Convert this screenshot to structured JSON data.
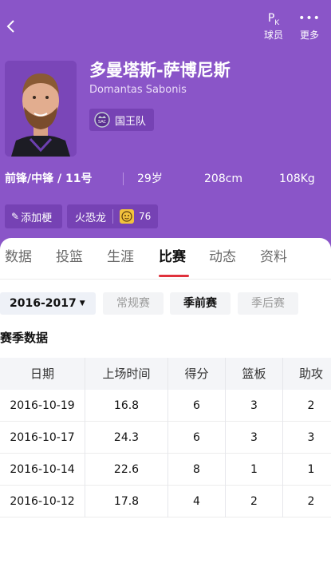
{
  "header": {
    "pk_label": "球员",
    "more_label": "更多",
    "player": {
      "name_cn": "多曼塔斯-萨博尼斯",
      "name_en": "Domantas Sabonis",
      "team": "国王队",
      "team_logo_text": "SAC",
      "position_number": "前锋/中锋 / 11号",
      "age": "29岁",
      "height": "208cm",
      "weight": "108Kg"
    },
    "tags": {
      "add_label": "添加梗",
      "fire_label": "火恐龙",
      "fire_count": "76"
    }
  },
  "tabs": [
    {
      "label": "数据"
    },
    {
      "label": "投篮"
    },
    {
      "label": "生涯"
    },
    {
      "label": "比赛",
      "active": true
    },
    {
      "label": "动态"
    },
    {
      "label": "资料"
    }
  ],
  "filters": {
    "season": "2016-2017",
    "types": [
      {
        "label": "常规赛"
      },
      {
        "label": "季前赛",
        "active": true
      },
      {
        "label": "季后赛"
      }
    ]
  },
  "section_title": "赛季数据",
  "table": {
    "headers": [
      "日期",
      "上场时间",
      "得分",
      "篮板",
      "助攻"
    ],
    "rows": [
      [
        "2016-10-19",
        "16.8",
        "6",
        "3",
        "2"
      ],
      [
        "2016-10-17",
        "24.3",
        "6",
        "3",
        "3"
      ],
      [
        "2016-10-14",
        "22.6",
        "8",
        "1",
        "1"
      ],
      [
        "2016-10-12",
        "17.8",
        "4",
        "2",
        "2"
      ]
    ]
  },
  "colors": {
    "header_bg": "#8a55c8",
    "accent_red": "#e0313b"
  }
}
